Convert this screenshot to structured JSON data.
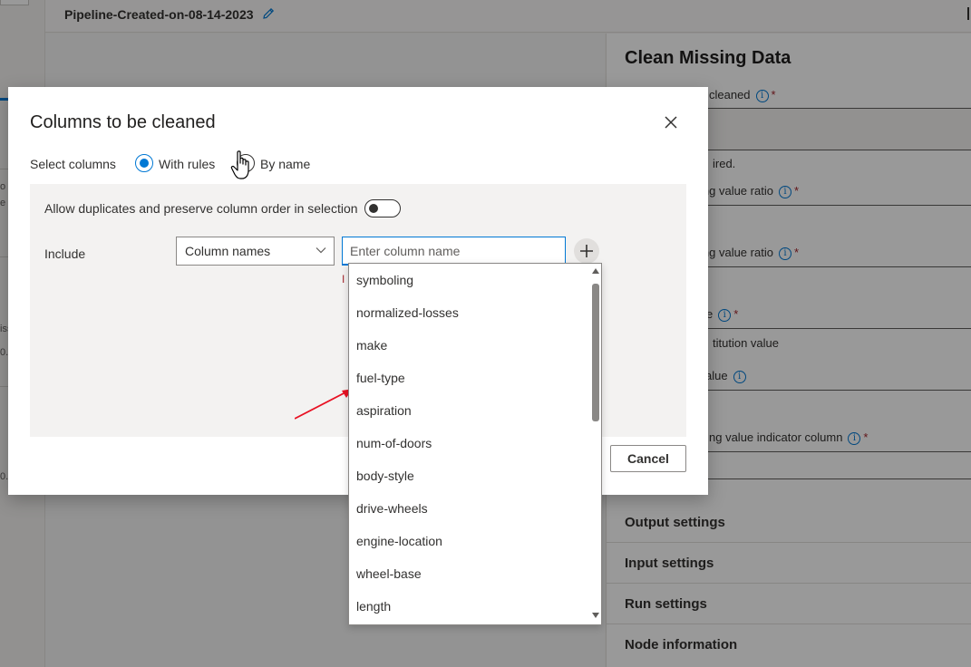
{
  "app": {
    "pipeline_title": "Pipeline-Created-on-08-14-2023",
    "left_fragments": [
      "o",
      "e",
      "iss",
      "0.",
      "0."
    ]
  },
  "panel": {
    "title": "Clean Missing Data",
    "fields": [
      {
        "label": "cleaned"
      },
      {
        "label": "ired."
      },
      {
        "label": "ing value ratio"
      },
      {
        "label": "ing value ratio"
      },
      {
        "label": "e"
      },
      {
        "label": "titution value"
      },
      {
        "label": "alue"
      },
      {
        "label": "ng value indicator column"
      }
    ],
    "sections": [
      "Output settings",
      "Input settings",
      "Run settings",
      "Node information"
    ]
  },
  "dialog": {
    "title": "Columns to be cleaned",
    "select_columns_label": "Select columns",
    "radio_with_rules": "With rules",
    "radio_by_name": "By name",
    "allow_duplicates_label": "Allow duplicates and preserve column order in selection",
    "include_label": "Include",
    "dropdown_value": "Column names",
    "input_placeholder": "Enter column name",
    "error_fragment": "I",
    "cancel_label": "Cancel"
  },
  "column_list": [
    "symboling",
    "normalized-losses",
    "make",
    "fuel-type",
    "aspiration",
    "num-of-doors",
    "body-style",
    "drive-wheels",
    "engine-location",
    "wheel-base",
    "length"
  ],
  "colors": {
    "accent": "#0078d4",
    "required": "#a4262c",
    "annotation_arrow": "#e81123"
  }
}
